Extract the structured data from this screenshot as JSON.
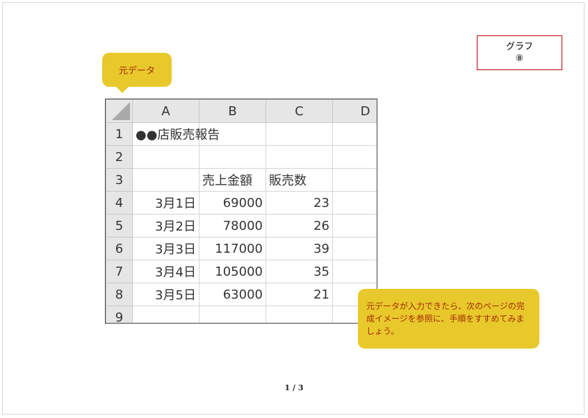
{
  "title_box": {
    "line1": "グラフ",
    "line2": "⑧"
  },
  "callout_top": {
    "text": "元データ"
  },
  "callout_bottom": {
    "text": "元データが入力できたら、次のページの完成イメージを参照に、手順をすすめてみましょう。"
  },
  "sheet": {
    "columns": [
      "A",
      "B",
      "C",
      "D"
    ],
    "rows": [
      {
        "num": "1",
        "cells": [
          "●●店販売報告",
          "",
          "",
          ""
        ]
      },
      {
        "num": "2",
        "cells": [
          "",
          "",
          "",
          ""
        ]
      },
      {
        "num": "3",
        "cells": [
          "",
          "売上金額",
          "販売数",
          ""
        ]
      },
      {
        "num": "4",
        "cells": [
          "3月1日",
          "69000",
          "23",
          ""
        ]
      },
      {
        "num": "5",
        "cells": [
          "3月2日",
          "78000",
          "26",
          ""
        ]
      },
      {
        "num": "6",
        "cells": [
          "3月3日",
          "117000",
          "39",
          ""
        ]
      },
      {
        "num": "7",
        "cells": [
          "3月4日",
          "105000",
          "35",
          ""
        ]
      },
      {
        "num": "8",
        "cells": [
          "3月5日",
          "63000",
          "21",
          ""
        ]
      },
      {
        "num": "9",
        "cells": [
          "",
          "",
          "",
          ""
        ]
      }
    ]
  },
  "page_number": "1 / 3",
  "colors": {
    "callout_fill": "#e8c92c",
    "callout_text": "#a52a00",
    "title_border": "#c00000"
  }
}
